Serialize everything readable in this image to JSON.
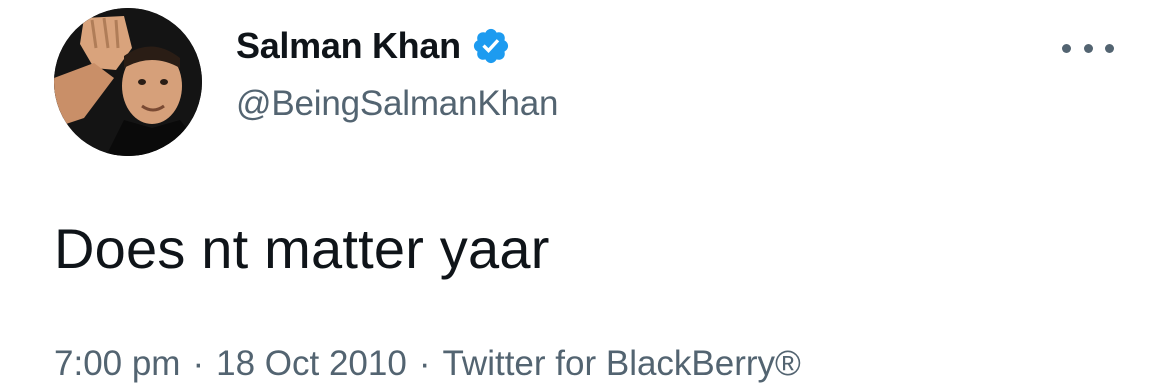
{
  "user": {
    "display_name": "Salman Khan",
    "handle": "@BeingSalmanKhan",
    "verified": true
  },
  "tweet": {
    "text": "Does nt matter yaar",
    "time": "7:00 pm",
    "date": "18 Oct 2010",
    "source": "Twitter for BlackBerry®",
    "separator": "·"
  },
  "icons": {
    "verified": "verified-badge-icon",
    "more": "more-options-icon"
  },
  "colors": {
    "text_primary": "#0f1419",
    "text_secondary": "#536471",
    "verified_blue": "#1d9bf0"
  }
}
